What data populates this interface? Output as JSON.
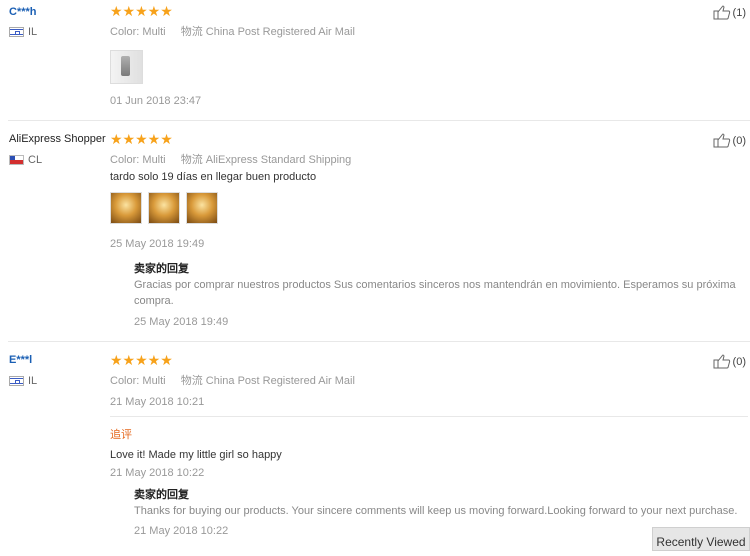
{
  "reviews": [
    {
      "name": "C***h",
      "country": "IL",
      "color_label": "Color:",
      "color_value": "Multi",
      "shipping_label": "物流",
      "shipping_value": "China Post Registered Air Mail",
      "stars": "★★★★★",
      "date": "01 Jun 2018 23:47",
      "likes": "(1)"
    },
    {
      "name": "AliExpress Shopper",
      "country": "CL",
      "color_label": "Color:",
      "color_value": "Multi",
      "shipping_label": "物流",
      "shipping_value": "AliExpress Standard Shipping",
      "stars": "★★★★★",
      "text": "tardo solo 19 días en llegar buen producto",
      "date": "25 May 2018 19:49",
      "likes": "(0)",
      "reply": {
        "title": "卖家的回复",
        "text": "Gracias por comprar nuestros productos Sus comentarios sinceros nos mantendrán en movimiento. Esperamos su próxima compra.",
        "date": "25 May 2018 19:49"
      }
    },
    {
      "name": "E***l",
      "country": "IL",
      "color_label": "Color:",
      "color_value": "Multi",
      "shipping_label": "物流",
      "shipping_value": "China Post Registered Air Mail",
      "stars": "★★★★★",
      "date": "21 May 2018 10:21",
      "likes": "(0)",
      "append_label": "追评",
      "append_text": "Love it! Made my little girl so happy",
      "append_date": "21 May 2018 10:22",
      "reply": {
        "title": "卖家的回复",
        "text": "Thanks for buying our products. Your sincere comments will keep us moving forward.Looking forward to your next purchase.",
        "date": "21 May 2018 10:22"
      }
    }
  ],
  "recently_viewed": "Recently Viewed",
  "colors": {
    "star": "#f7a21b",
    "name_link": "#1a5fb4",
    "append": "#e5691f"
  }
}
